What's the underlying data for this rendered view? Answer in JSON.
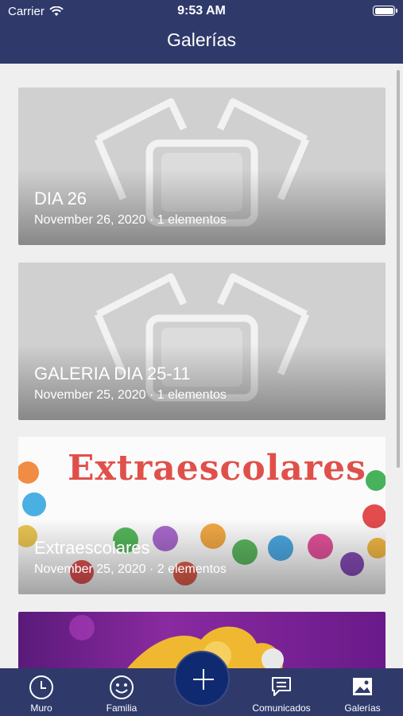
{
  "status_bar": {
    "carrier": "Carrier",
    "time": "9:53 AM"
  },
  "nav": {
    "title": "Galerías"
  },
  "galleries": [
    {
      "title": "DIA 26",
      "subtitle": "November 26, 2020 · 1 elementos"
    },
    {
      "title": "GALERIA DIA 25-11",
      "subtitle": "November 25, 2020 · 1 elementos"
    },
    {
      "title": "Extraescolares",
      "subtitle": "November 25, 2020 · 2 elementos",
      "image_text": "Extraescolares"
    }
  ],
  "tabs": [
    {
      "label": "Muro",
      "icon": "clock-icon"
    },
    {
      "label": "Familia",
      "icon": "smiley-icon"
    },
    {
      "label": "Comunicados",
      "icon": "message-icon"
    },
    {
      "label": "Galerías",
      "icon": "gallery-icon"
    }
  ],
  "fab": {
    "icon": "plus-icon"
  },
  "colors": {
    "bar": "#2f3a6b",
    "fab": "#0f2a70"
  }
}
